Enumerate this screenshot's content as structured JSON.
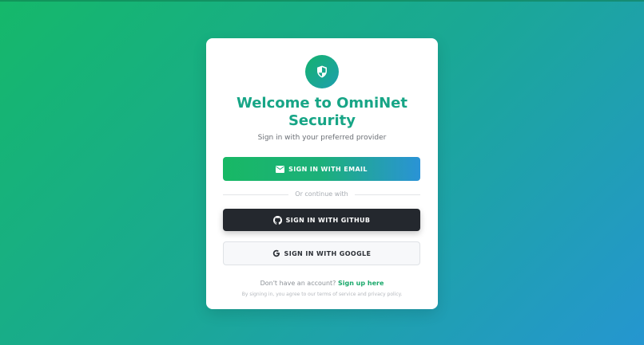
{
  "card": {
    "title": "Welcome to OmniNet Security",
    "subtitle": "Sign in with your preferred provider",
    "buttons": {
      "email": "SIGN IN WITH EMAIL",
      "github": "SIGN IN WITH GITHUB",
      "google": "SIGN IN WITH GOOGLE"
    },
    "divider_text": "Or continue with",
    "signup_prompt": "Don't have an account?",
    "signup_link": "Sign up here",
    "terms": "By signing in, you agree to our terms of service and privacy policy."
  },
  "icons": {
    "logo": "shield-icon",
    "email": "mail-icon",
    "github": "github-icon",
    "google": "google-icon"
  },
  "colors": {
    "background_start": "#15b86a",
    "background_end": "#2596d0",
    "title": "#17a586",
    "link": "#1aa86b",
    "github_button": "#24282e"
  }
}
